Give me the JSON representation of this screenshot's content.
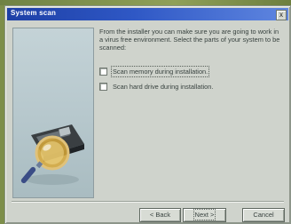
{
  "window": {
    "title": "System scan",
    "close_glyph": "x"
  },
  "content": {
    "description": "From the installer you can make sure you are going to work in a virus free environment. Select the parts of your system to be scanned:",
    "options": [
      {
        "label": "Scan memory during installation.",
        "checked": false
      },
      {
        "label": "Scan hard drive during installation.",
        "checked": false
      }
    ]
  },
  "buttons": {
    "back": "< Back",
    "next": "Next >",
    "cancel": "Cancel"
  },
  "icons": {
    "illustration": "magnifier-over-disk-icon",
    "close": "close-icon"
  },
  "colors": {
    "titlebar_start": "#1d3fa6",
    "titlebar_end": "#5f86e0",
    "window_bg": "#cfd3cc",
    "panel_bg": "#b7c8cd"
  }
}
